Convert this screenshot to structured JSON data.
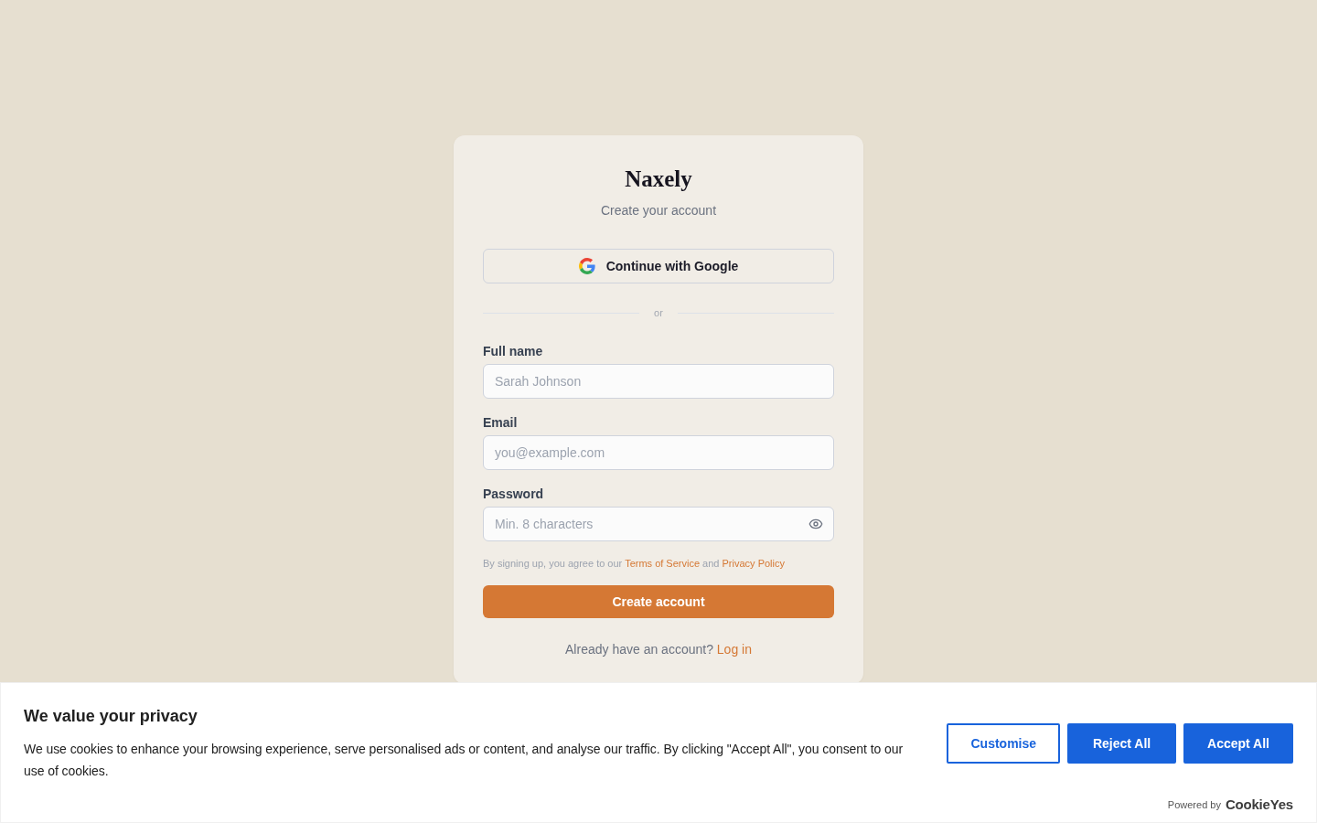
{
  "brand": {
    "name": "Naxely",
    "subtitle": "Create your account"
  },
  "google_button": {
    "label": "Continue with Google"
  },
  "divider": {
    "label": "or"
  },
  "fields": [
    {
      "label": "Full name",
      "placeholder": "Sarah Johnson",
      "kind": "text"
    },
    {
      "label": "Email",
      "placeholder": "you@example.com",
      "kind": "email"
    },
    {
      "label": "Password",
      "placeholder": "Min. 8 characters",
      "kind": "password"
    }
  ],
  "terms": [
    {
      "text": "By signing up, you agree to our",
      "kind": "plain"
    },
    {
      "text": "Terms of Service",
      "kind": "link"
    },
    {
      "text": "and",
      "kind": "plain"
    },
    {
      "text": "Privacy Policy",
      "kind": "link"
    }
  ],
  "submit_button": {
    "label": "Create account"
  },
  "login_prompt": {
    "text": "Already have an account?",
    "link": "Log in"
  },
  "cookie_banner": {
    "title": "We value your privacy",
    "body": "We use cookies to enhance your browsing experience, serve personalised ads or content, and analyse our traffic. By clicking \"Accept All\", you consent to our use of cookies.",
    "buttons": [
      {
        "label": "Customise",
        "kind": "outline"
      },
      {
        "label": "Reject All",
        "kind": "solid"
      },
      {
        "label": "Accept All",
        "kind": "solid"
      }
    ],
    "powered_by": "Powered by",
    "provider_logo": "CookieYes"
  }
}
